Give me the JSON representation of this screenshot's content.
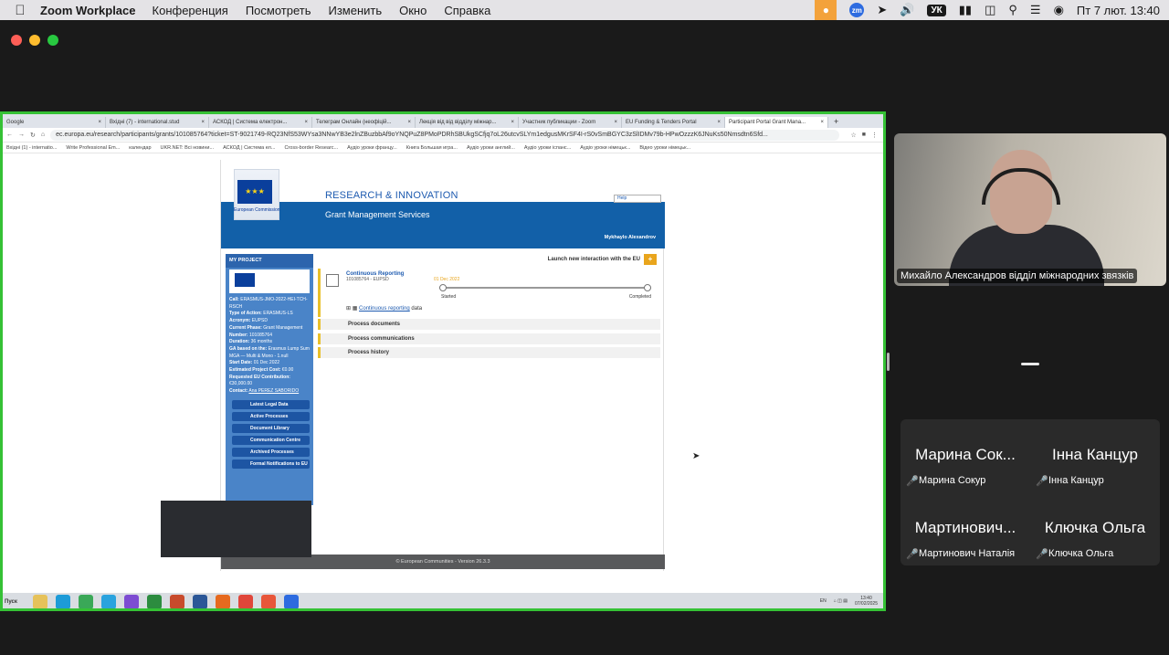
{
  "menubar": {
    "app_name": "Zoom Workplace",
    "menus": [
      "Конференция",
      "Посмотреть",
      "Изменить",
      "Окно",
      "Справка"
    ],
    "keyboard_layout": "УК",
    "datetime": "Пт 7 лют.  13:40",
    "zm_label": "zm"
  },
  "browser": {
    "tabs": [
      {
        "title": "Google",
        "active": false
      },
      {
        "title": "Вхідні (7) - international.stud",
        "active": false
      },
      {
        "title": "АСКОД | Система електрон...",
        "active": false
      },
      {
        "title": "Телеграм Онлайн (неофіцій...",
        "active": false
      },
      {
        "title": "Лекція від від відділу міжнар...",
        "active": false
      },
      {
        "title": "Участник публикации - Zoom",
        "active": false
      },
      {
        "title": "EU Funding & Tenders Portal",
        "active": false
      },
      {
        "title": "Participant Portal Grant Mana...",
        "active": true
      }
    ],
    "url": "ec.europa.eu/research/participants/grants/101085764?ticket=ST-9021749-RQ23NfS53WYsa3NNwYB3e2lnZBuzbbAf9oYNQPuZ8PMoPDRhSBUkgSCfjq7oL26utcvSLYm1edgusMKrSF4I-rS0vSmBGYC3zSlIDMv79b-HPwOzzzK6JNuKs50Nmsdtn6Sfd...",
    "bookmarks": [
      "Вхідні (1) - internatio...",
      "Write Professional Em...",
      "календар",
      "UKR.NET: Всі новини...",
      "АСКОД | Система ел...",
      "Cross-border Researc...",
      "Аудіо уроки францу...",
      "Книга Большая игра...",
      "Аудіо уроки англий...",
      "Аудіо уроки іспанс...",
      "Аудіо уроки німецьк...",
      "Відео уроки німецьк..."
    ]
  },
  "portal": {
    "ec_label": "European Commission",
    "title": "RESEARCH & INNOVATION",
    "subtitle": "Grant Management Services",
    "help_label": "Help",
    "user": "Mykhaylo Alexandrov",
    "my_project": "MY PROJECT",
    "project_info": {
      "call_label": "Call:",
      "call": "ERASMUS-JMO-2022-HEI-TCH-RSCH",
      "type_label": "Type of Action:",
      "type": "ERASMUS-LS",
      "acronym_label": "Acronym:",
      "acronym": "EUPSD",
      "phase_label": "Current Phase:",
      "phase": "Grant Management",
      "number_label": "Number:",
      "number": "101085764",
      "duration_label": "Duration:",
      "duration": "36 months",
      "ga_label": "GA based on the:",
      "ga": "Erasmus Lump Sum MGA — Multi & Mono - 1.null",
      "start_label": "Start Date:",
      "start": "01 Dec 2022",
      "cost_label": "Estimated Project Cost:",
      "cost": "€0.00",
      "contribution_label": "Requested EU Contribution:",
      "contribution": "€30,000.00",
      "contact_label": "Contact:",
      "contact": "Ana PEREZ SABORIDO"
    },
    "nav": [
      "Latest Legal Data",
      "Active Processes",
      "Document Library",
      "Communication Centre",
      "Archived Processes",
      "Formal Notifications to EU"
    ],
    "launch_label": "Launch new interaction with the EU",
    "process": {
      "title": "Continuous Reporting",
      "subtitle": "101085764 - EUPSD",
      "date": "01 Dec 2022",
      "started": "Started",
      "completed": "Completed",
      "data_link": "Continuous reporting",
      "data_suffix": "data"
    },
    "sections": [
      "Process documents",
      "Process communications",
      "Process history"
    ],
    "footer": "© European Communities - Version 26.3.3"
  },
  "taskbar": {
    "start": "Пуск",
    "lang": "EN",
    "time": "13:40",
    "date": "07/02/2025"
  },
  "speaker": {
    "name": "Михайло Александров відділ міжнародних звязків"
  },
  "participants": [
    {
      "display": "Марина Сок...",
      "name": "Марина Сокур"
    },
    {
      "display": "Інна Канцур",
      "name": "Інна Канцур"
    },
    {
      "display": "Мартинович...",
      "name": "Мартинович Наталія"
    },
    {
      "display": "Ключка Ольга",
      "name": "Ключка Ольга"
    }
  ]
}
